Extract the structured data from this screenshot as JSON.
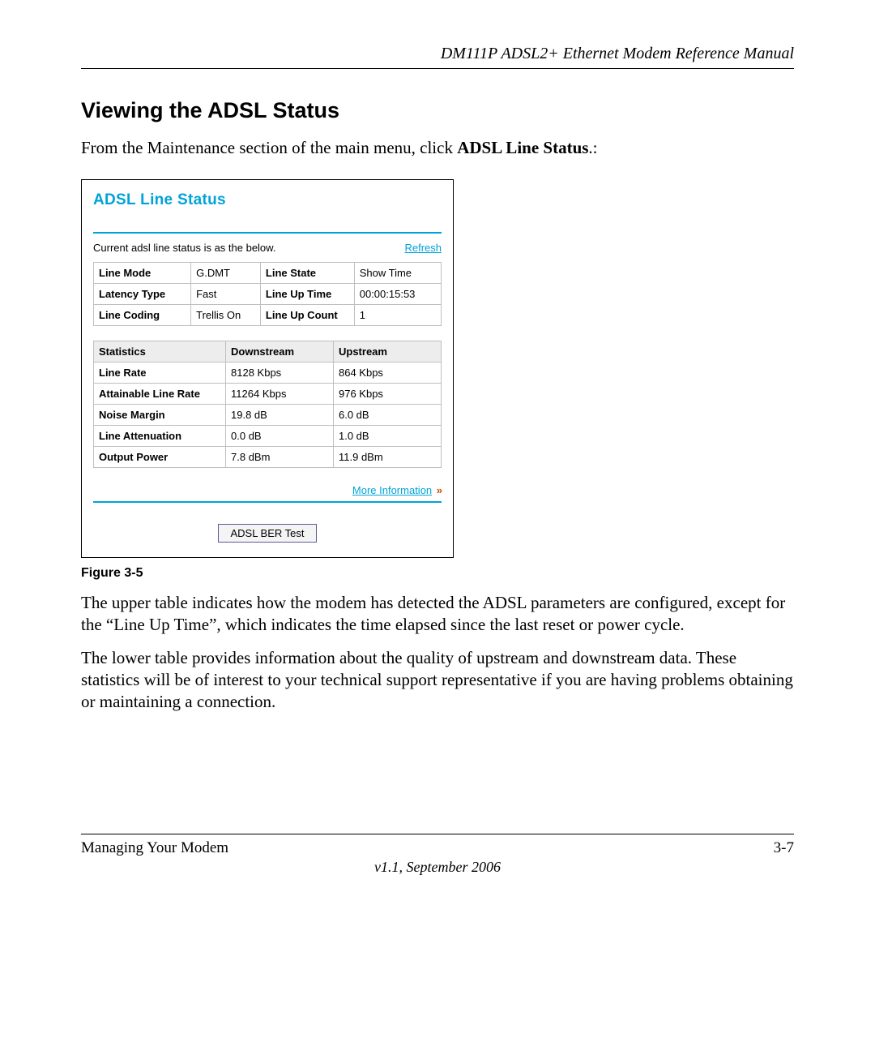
{
  "header": {
    "title": "DM111P ADSL2+ Ethernet Modem Reference Manual"
  },
  "section": {
    "heading": "Viewing the ADSL Status",
    "intro_pre": "From the Maintenance section of the main menu, click ",
    "intro_bold": "ADSL Line Status",
    "intro_post": ".:"
  },
  "panel": {
    "title": "ADSL Line Status",
    "status_text": "Current adsl line status is as the below.",
    "refresh": "Refresh",
    "table1": {
      "r1": {
        "l1": "Line Mode",
        "v1": "G.DMT",
        "l2": "Line State",
        "v2": "Show Time"
      },
      "r2": {
        "l1": "Latency Type",
        "v1": "Fast",
        "l2": "Line Up Time",
        "v2": "00:00:15:53"
      },
      "r3": {
        "l1": "Line Coding",
        "v1": "Trellis On",
        "l2": "Line Up Count",
        "v2": "1"
      }
    },
    "table2": {
      "head": {
        "c1": "Statistics",
        "c2": "Downstream",
        "c3": "Upstream"
      },
      "rows": {
        "r1": {
          "label": "Line Rate",
          "d": "8128 Kbps",
          "u": "864 Kbps"
        },
        "r2": {
          "label": "Attainable Line Rate",
          "d": "11264 Kbps",
          "u": "976 Kbps"
        },
        "r3": {
          "label": "Noise Margin",
          "d": "19.8 dB",
          "u": "6.0 dB"
        },
        "r4": {
          "label": "Line Attenuation",
          "d": "0.0 dB",
          "u": "1.0 dB"
        },
        "r5": {
          "label": "Output Power",
          "d": "7.8 dBm",
          "u": "11.9 dBm"
        }
      }
    },
    "more_info": "More Information",
    "ber_button": "ADSL BER Test"
  },
  "figure_caption": "Figure 3-5",
  "para1": "The upper table indicates how the modem has detected the ADSL parameters are configured, except for the “Line Up Time”, which indicates the time elapsed since the last reset or power cycle.",
  "para2": "The lower table provides information about the quality of upstream and downstream data. These statistics will be of interest to your technical support representative if you are having problems obtaining or maintaining a connection.",
  "footer": {
    "left": "Managing Your Modem",
    "right": "3-7",
    "version": "v1.1, September 2006"
  },
  "chart_data": [
    {
      "type": "table",
      "title": "ADSL Line Status — detected parameters",
      "rows": [
        {
          "Line Mode": "G.DMT",
          "Line State": "Show Time"
        },
        {
          "Latency Type": "Fast",
          "Line Up Time": "00:00:15:53"
        },
        {
          "Line Coding": "Trellis On",
          "Line Up Count": "1"
        }
      ]
    },
    {
      "type": "table",
      "title": "ADSL Line Status — statistics",
      "columns": [
        "Statistics",
        "Downstream",
        "Upstream"
      ],
      "rows": [
        [
          "Line Rate",
          "8128 Kbps",
          "864 Kbps"
        ],
        [
          "Attainable Line Rate",
          "11264 Kbps",
          "976 Kbps"
        ],
        [
          "Noise Margin",
          "19.8 dB",
          "6.0 dB"
        ],
        [
          "Line Attenuation",
          "0.0 dB",
          "1.0 dB"
        ],
        [
          "Output Power",
          "7.8 dBm",
          "11.9 dBm"
        ]
      ]
    }
  ]
}
